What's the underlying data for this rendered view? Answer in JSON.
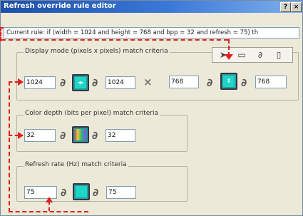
{
  "window": {
    "title": "Refresh override rule editor",
    "help_label": "?",
    "close_label": "×"
  },
  "current_rule": "Current rule: if (width = 1024 and height = 768 and bpp = 32 and refresh = 75) th",
  "display_mode": {
    "label": "Display mode (pixels x pixels) match criteria",
    "width_min": "1024",
    "width_max": "1024",
    "height_min": "768",
    "height_max": "768"
  },
  "color_depth": {
    "label": "Color depth (bits per pixel) match criteria",
    "min": "32",
    "max": "32"
  },
  "refresh_rate": {
    "label": "Refresh rate (Hz) match criteria",
    "min": "75",
    "max": "75"
  },
  "icons": {
    "toolbar": [
      "mouse-pointer-icon",
      "rectangle-icon",
      "link-icon",
      "trash-icon"
    ],
    "link": "chain-link-icon",
    "times": "times-icon"
  },
  "colors": {
    "annotation_red": "#e02020",
    "title_blue": "#1c4fa8",
    "monitor_teal": "#1dd6c8"
  }
}
